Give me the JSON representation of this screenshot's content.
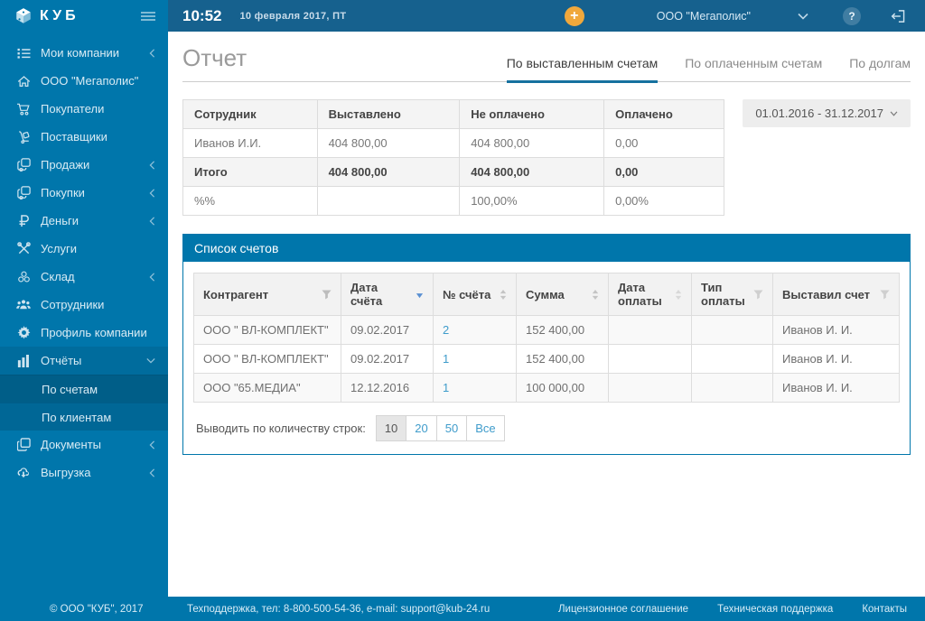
{
  "brand": {
    "name": "КУБ"
  },
  "topbar": {
    "time": "10:52",
    "date": "10 февраля 2017, ПТ",
    "company": "ООО \"Мегаполис\"",
    "plus_label": "+",
    "help_label": "?"
  },
  "sidebar": {
    "items": [
      "Мои компании",
      "ООО \"Мегаполис\"",
      "Покупатели",
      "Поставщики",
      "Продажи",
      "Покупки",
      "Деньги",
      "Услуги",
      "Склад",
      "Сотрудники",
      "Профиль компании",
      "Отчёты",
      "По счетам",
      "По клиентам",
      "Документы",
      "Выгрузка"
    ]
  },
  "page": {
    "title": "Отчет"
  },
  "tabs": [
    "По выставленным счетам",
    "По оплаченным счетам",
    "По долгам"
  ],
  "active_tab": "По выставленным счетам",
  "date_range": "01.01.2016 - 31.12.2017",
  "summary": {
    "headers": [
      "Сотрудник",
      "Выставлено",
      "Не оплачено",
      "Оплачено"
    ],
    "rows": [
      [
        "Иванов И.И.",
        "404 800,00",
        "404 800,00",
        "0,00"
      ],
      [
        "Итого",
        "404 800,00",
        "404 800,00",
        "0,00"
      ],
      [
        "%%",
        "",
        "100,00%",
        "0,00%"
      ]
    ]
  },
  "invoices": {
    "panel_title": "Список счетов",
    "headers": [
      "Контрагент",
      "Дата счёта",
      "№ счёта",
      "Сумма",
      "Дата оплаты",
      "Тип оплаты",
      "Выставил счет"
    ],
    "rows": [
      [
        "ООО \" ВЛ-КОМПЛЕКТ\"",
        "09.02.2017",
        "2",
        "152 400,00",
        "",
        "",
        "Иванов И. И."
      ],
      [
        "ООО \" ВЛ-КОМПЛЕКТ\"",
        "09.02.2017",
        "1",
        "152 400,00",
        "",
        "",
        "Иванов И. И."
      ],
      [
        "ООО \"65.МЕДИА\"",
        "12.12.2016",
        "1",
        "100 000,00",
        "",
        "",
        "Иванов И. И."
      ]
    ]
  },
  "pagination": {
    "label": "Выводить по количеству строк:",
    "options": [
      "10",
      "20",
      "50",
      "Все"
    ],
    "active": "10"
  },
  "footer": {
    "copyright": "© ООО \"КУБ\", 2017",
    "support": "Техподдержка, тел: 8-800-500-54-36, e-mail: support@kub-24.ru",
    "links": [
      "Лицензионное соглашение",
      "Техническая поддержка",
      "Контакты"
    ]
  },
  "icons": {
    "cube-logo-icon": "3d-cube",
    "hamburger-icon": "three-lines",
    "list-icon": "bulleted-list",
    "home-icon": "house",
    "cart-icon": "shopping-cart",
    "dolly-icon": "hand-truck",
    "sales-icon": "overlapping-sheets-gear",
    "purchases-icon": "overlapping-sheets-gear",
    "ruble-icon": "₽",
    "tools-icon": "crossed-tools",
    "warehouse-icon": "stacked-balls",
    "employees-icon": "people-group",
    "gear-icon": "⚙",
    "reports-icon": "bar-chart",
    "documents-icon": "document-copy",
    "export-icon": "cloud-download",
    "chevron-left-icon": "‹",
    "chevron-down-icon": "⌄",
    "filter-icon": "funnel",
    "sort-icon": "up-down-arrows",
    "sort-desc-icon": "blue-down-arrow",
    "logout-icon": "door-arrow",
    "help-icon": "?"
  },
  "colors": {
    "sidebar_blue": "#0076ab",
    "topbar_blue": "#16618e",
    "accent_orange": "#f0a83c",
    "link_blue": "#3f9ccb",
    "tab_underline": "#15719f"
  }
}
